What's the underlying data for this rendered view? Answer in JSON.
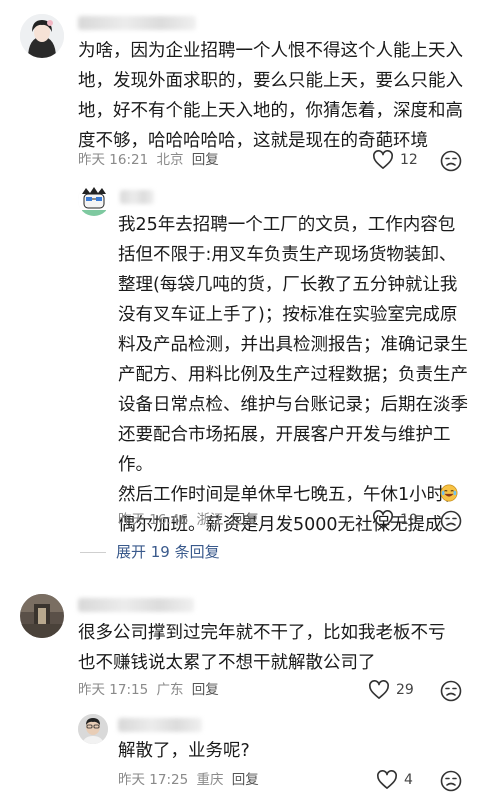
{
  "comments": [
    {
      "text": "为啥，因为企业招聘一个人恨不得这个人能上天入地，发现外面求职的，要么只能上天，要么只能入地，好不有个能上天入地的，你猜怎着，深度和高度不够，哈哈哈哈哈，这就是现在的奇葩环境",
      "time": "昨天 16:21",
      "location": "北京",
      "reply_label": "回复",
      "likes": "12"
    },
    {
      "text": "我25年去招聘一个工厂的文员，工作内容包括但不限于:用叉车负责生产现场货物装卸、整理(每袋几吨的货，厂长教了五分钟就让我没有叉车证上手了)；按标准在实验室完成原料及产品检测，并出具检测报告；准确记录生产配方、用料比例及生产过程数据；负责生产设备日常点检、维护与台账记录；后期在淡季还要配合市场拓展，开展客户开发与维护工作。\n然后工作时间是单休早七晚五，午休1小时，偶尔加班。薪资是月发5000无社保无提成",
      "time": "昨天 16:46",
      "location": "浙江",
      "reply_label": "回复",
      "likes": "10"
    },
    {
      "text": "很多公司撑到过完年就不干了，比如我老板不亏也不赚钱说太累了不想干就解散公司了",
      "time": "昨天 17:15",
      "location": "广东",
      "reply_label": "回复",
      "likes": "29"
    },
    {
      "text": "解散了，业务呢?",
      "time": "昨天 17:25",
      "location": "重庆",
      "reply_label": "回复",
      "likes": "4"
    }
  ],
  "expand_replies": "展开 19 条回复",
  "icons": {
    "like": "heart-outline-icon",
    "dislike": "dislike-face-icon",
    "emoji": "laughing-tears-emoji"
  },
  "colors": {
    "link": "#3a5a8c",
    "meta": "#8a8a8a"
  }
}
